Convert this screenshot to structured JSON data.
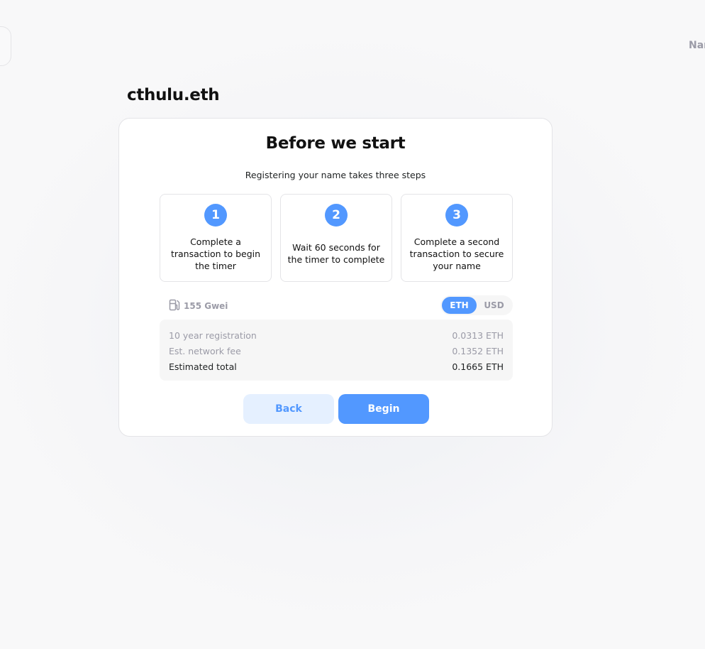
{
  "header": {
    "right_nav_text": "Nar"
  },
  "page": {
    "name": "cthulu.eth"
  },
  "card": {
    "title": "Before we start",
    "subtitle": "Registering your name takes three steps",
    "steps": [
      {
        "number": "1",
        "text": "Complete a transaction to begin the timer"
      },
      {
        "number": "2",
        "text": "Wait 60 seconds for the timer to complete"
      },
      {
        "number": "3",
        "text": "Complete a second transaction to secure your name"
      }
    ],
    "gas": {
      "icon": "gas-pump-icon",
      "value": "155 Gwei"
    },
    "currency_toggle": {
      "options": [
        "ETH",
        "USD"
      ],
      "selected": "ETH"
    },
    "fees": [
      {
        "label": "10 year registration",
        "value": "0.0313 ETH"
      },
      {
        "label": "Est. network fee",
        "value": "0.1352 ETH"
      },
      {
        "label": "Estimated total",
        "value": "0.1665 ETH"
      }
    ],
    "buttons": {
      "back": "Back",
      "begin": "Begin"
    }
  },
  "colors": {
    "accent": "#5298ff",
    "accent_light": "#e5f0ff",
    "muted_text": "#9b9ba7",
    "panel_bg": "#f6f6f6"
  }
}
